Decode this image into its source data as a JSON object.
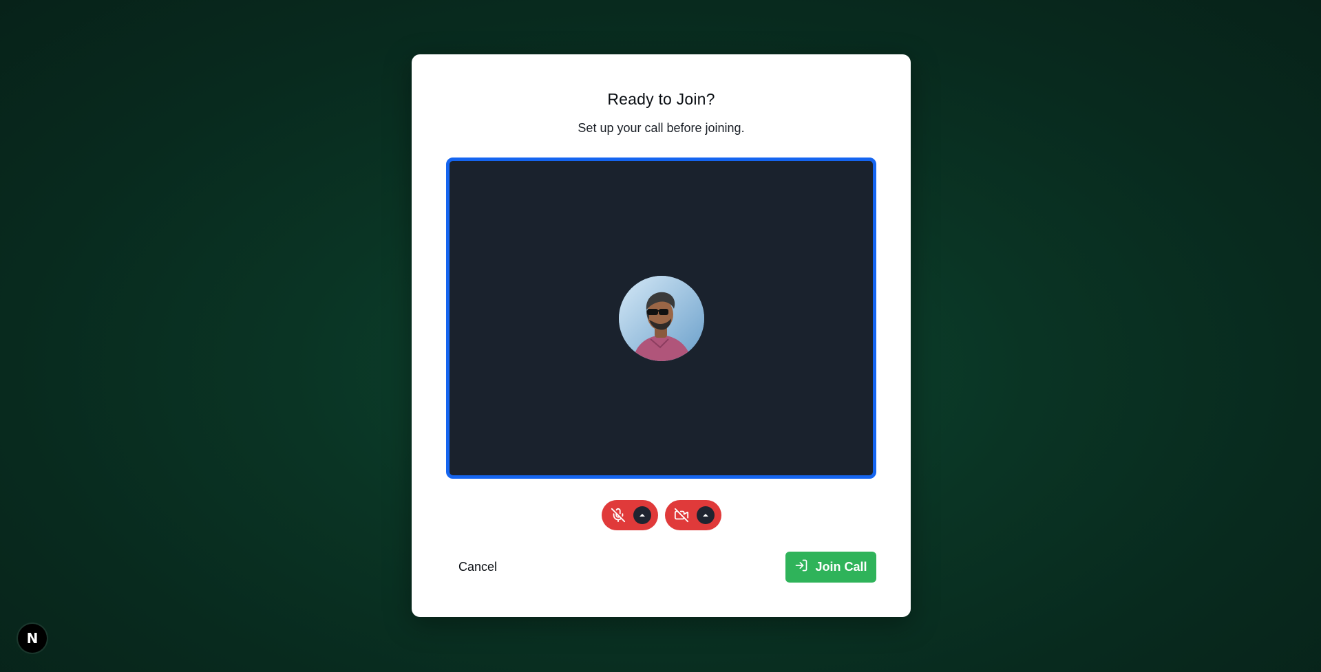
{
  "dialog": {
    "title": "Ready to Join?",
    "subtitle": "Set up your call before joining."
  },
  "preview": {
    "avatar_icon": "user-avatar",
    "border_color": "#1565f0",
    "background_color": "#1a222d"
  },
  "controls": {
    "microphone": {
      "icon": "mic-off-icon",
      "state": "off",
      "caret_icon": "caret-up-icon"
    },
    "camera": {
      "icon": "video-off-icon",
      "state": "off",
      "caret_icon": "caret-up-icon"
    },
    "off_color": "#e03a3a"
  },
  "actions": {
    "cancel_label": "Cancel",
    "join_label": "Join Call",
    "join_icon": "sign-in-icon",
    "join_color": "#2fb35a"
  },
  "badge": {
    "letter": "N"
  }
}
